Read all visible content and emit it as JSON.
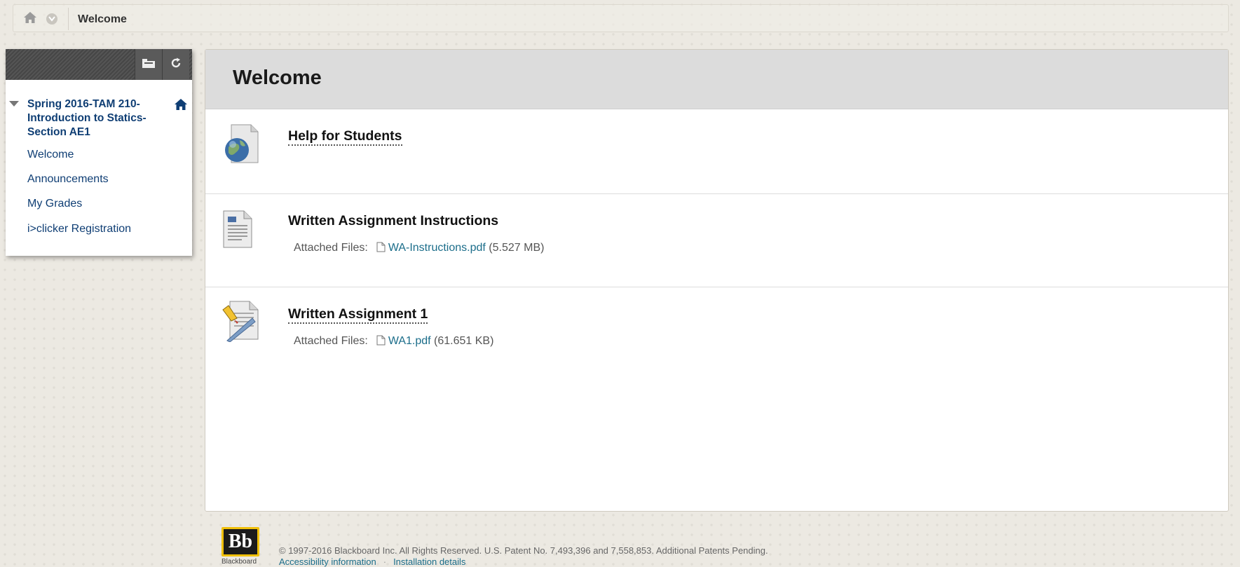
{
  "breadcrumb": {
    "title": "Welcome"
  },
  "course_menu": {
    "course_title": "Spring 2016-TAM 210-Introduction to Statics-Section AE1",
    "items": [
      {
        "label": "Welcome"
      },
      {
        "label": "Announcements"
      },
      {
        "label": "My Grades"
      },
      {
        "label": "i>clicker Registration"
      }
    ]
  },
  "content": {
    "title": "Welcome",
    "items": [
      {
        "title": "Help for Students",
        "icon": "web-link-icon"
      },
      {
        "title": "Written Assignment Instructions",
        "icon": "document-icon",
        "attached_label": "Attached Files:",
        "file_name": "WA-Instructions.pdf",
        "file_size": "(5.527 MB)"
      },
      {
        "title": "Written Assignment 1",
        "icon": "assignment-icon",
        "attached_label": "Attached Files:",
        "file_name": "WA1.pdf",
        "file_size": "(61.651 KB)"
      }
    ]
  },
  "footer": {
    "logo_text": "Bb",
    "logo_sub": "Blackboard",
    "copyright": "© 1997-2016 Blackboard Inc. All Rights Reserved. U.S. Patent No. 7,493,396 and 7,558,853. Additional Patents Pending.",
    "link_accessibility": "Accessibility information",
    "link_separator": "·",
    "link_installation": "Installation details"
  },
  "colors": {
    "link_blue": "#0f3e74",
    "file_link": "#1b6d8a",
    "logo_border": "#f0c00a"
  }
}
